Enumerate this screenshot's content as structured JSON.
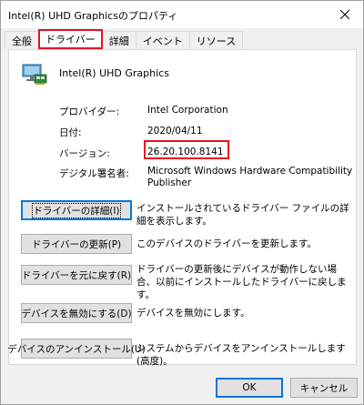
{
  "window": {
    "title": "Intel(R) UHD Graphicsのプロパティ"
  },
  "tabs": [
    {
      "label": "全般"
    },
    {
      "label": "ドライバー"
    },
    {
      "label": "詳細"
    },
    {
      "label": "イベント"
    },
    {
      "label": "リソース"
    }
  ],
  "device": {
    "name": "Intel(R) UHD Graphics"
  },
  "properties": {
    "provider_label": "プロバイダー:",
    "provider_value": "Intel Corporation",
    "date_label": "日付:",
    "date_value": "2020/04/11",
    "version_label": "バージョン:",
    "version_value": "26.20.100.8141",
    "signer_label": "デジタル署名者:",
    "signer_value": "Microsoft Windows Hardware Compatibility Publisher"
  },
  "actions": [
    {
      "label": "ドライバーの詳細(I)",
      "description": "インストールされているドライバー ファイルの詳細を表示します。"
    },
    {
      "label": "ドライバーの更新(P)",
      "description": "このデバイスのドライバーを更新します。"
    },
    {
      "label": "ドライバーを元に戻す(R)",
      "description": "ドライバーの更新後にデバイスが動作しない場合、以前にインストールしたドライバーに戻します。"
    },
    {
      "label": "デバイスを無効にする(D)",
      "description": "デバイスを無効にします。"
    },
    {
      "label": "デバイスのアンインストール(U)",
      "description": "システムからデバイスをアンインストールします (高度)。"
    }
  ],
  "footer": {
    "ok_label": "OK",
    "cancel_label": "キャンセル"
  },
  "colors": {
    "highlight": "#e81123",
    "focus": "#0078d7"
  }
}
